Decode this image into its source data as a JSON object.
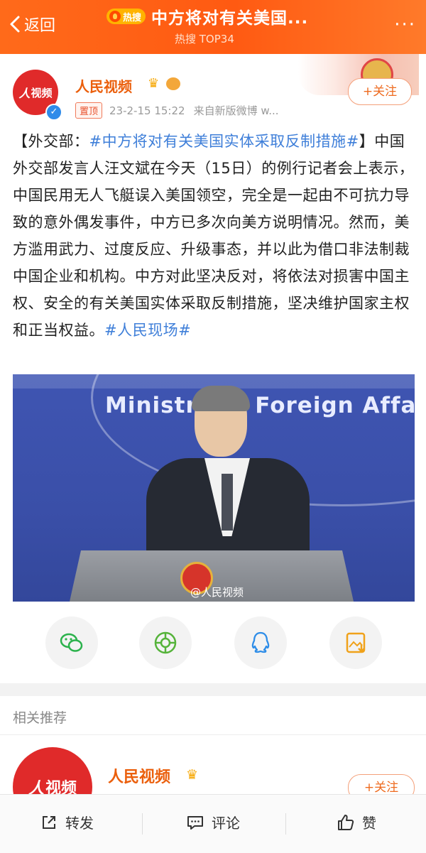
{
  "header": {
    "back_label": "返回",
    "hot_badge": "热搜",
    "title": "中方将对有关美国...",
    "subtitle": "热搜 TOP34",
    "more_label": "···"
  },
  "post": {
    "author": "人民视频",
    "avatar_text": "视频",
    "pin_label": "置顶",
    "time": "23-2-15 15:22",
    "source": "来自新版微博 w...",
    "follow_label": "+关注",
    "text_prefix": "【外交部：",
    "topic_tag": "#中方将对有关美国实体采取反制措施#",
    "text_body": "】中国外交部发言人汪文斌在今天（15日）的例行记者会上表示，中国民用无人飞艇误入美国领空，完全是一起由不可抗力导致的意外偶发事件，中方已多次向美方说明情况。然而，美方滥用武力、过度反应、升级事态，并以此为借口非法制裁中国企业和机构。中方对此坚决反对，将依法对损害中国主权、安全的有关美国实体采取反制措施，坚决维护国家主权和正当权益。",
    "end_tag": "#人民现场#",
    "image_text": "Ministry of Foreign Affa",
    "image_watermark": "@人民视频"
  },
  "share": {
    "wechat_icon": "wechat-icon",
    "moments_icon": "moments-icon",
    "qq_icon": "qq-icon",
    "save_image_icon": "save-image-icon"
  },
  "related": {
    "label": "相关推荐",
    "author": "人民视频",
    "avatar_text": "视频",
    "follow_label": "+关注"
  },
  "bottom_bar": {
    "repost_label": "转发",
    "comment_label": "评论",
    "like_label": "赞"
  },
  "colors": {
    "header_orange": "#ff5a12",
    "name_orange": "#eb5f0c",
    "topic_blue": "#3f7fd9",
    "brand_red": "#e02a2a"
  }
}
